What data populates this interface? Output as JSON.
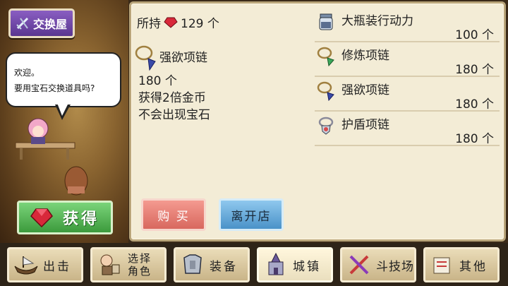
{
  "shop": {
    "title": "交换屋",
    "greeting_line1": "欢迎。",
    "greeting_line2": "要用宝石交换道具吗?",
    "get_label": "获得"
  },
  "detail": {
    "owned_label": "所持",
    "owned_count": "129 个",
    "item_name": "强欲项链",
    "cost": "180 个",
    "effect1": "获得2倍金币",
    "effect2": "不会出现宝石",
    "buy_label": "购 买",
    "leave_label": "离开店"
  },
  "items": [
    {
      "name": "大瓶装行动力",
      "price": "100 个",
      "icon": "potion-bottle-icon"
    },
    {
      "name": "修炼项链",
      "price": "180 个",
      "icon": "training-necklace-icon"
    },
    {
      "name": "强欲项链",
      "price": "180 个",
      "icon": "greed-necklace-icon"
    },
    {
      "name": "护盾项链",
      "price": "180 个",
      "icon": "shield-necklace-icon"
    }
  ],
  "nav": {
    "sortie": "出击",
    "select_line1": "选择",
    "select_line2": "角色",
    "equip": "装备",
    "town": "城镇",
    "arena": "斗技场",
    "other": "其他"
  },
  "colors": {
    "panel_bg": "#f3ecd6",
    "buy_button": "#e07a70",
    "leave_button": "#5ea4d6",
    "get_button": "#4caa4c",
    "shop_badge": "#6a44a4"
  }
}
